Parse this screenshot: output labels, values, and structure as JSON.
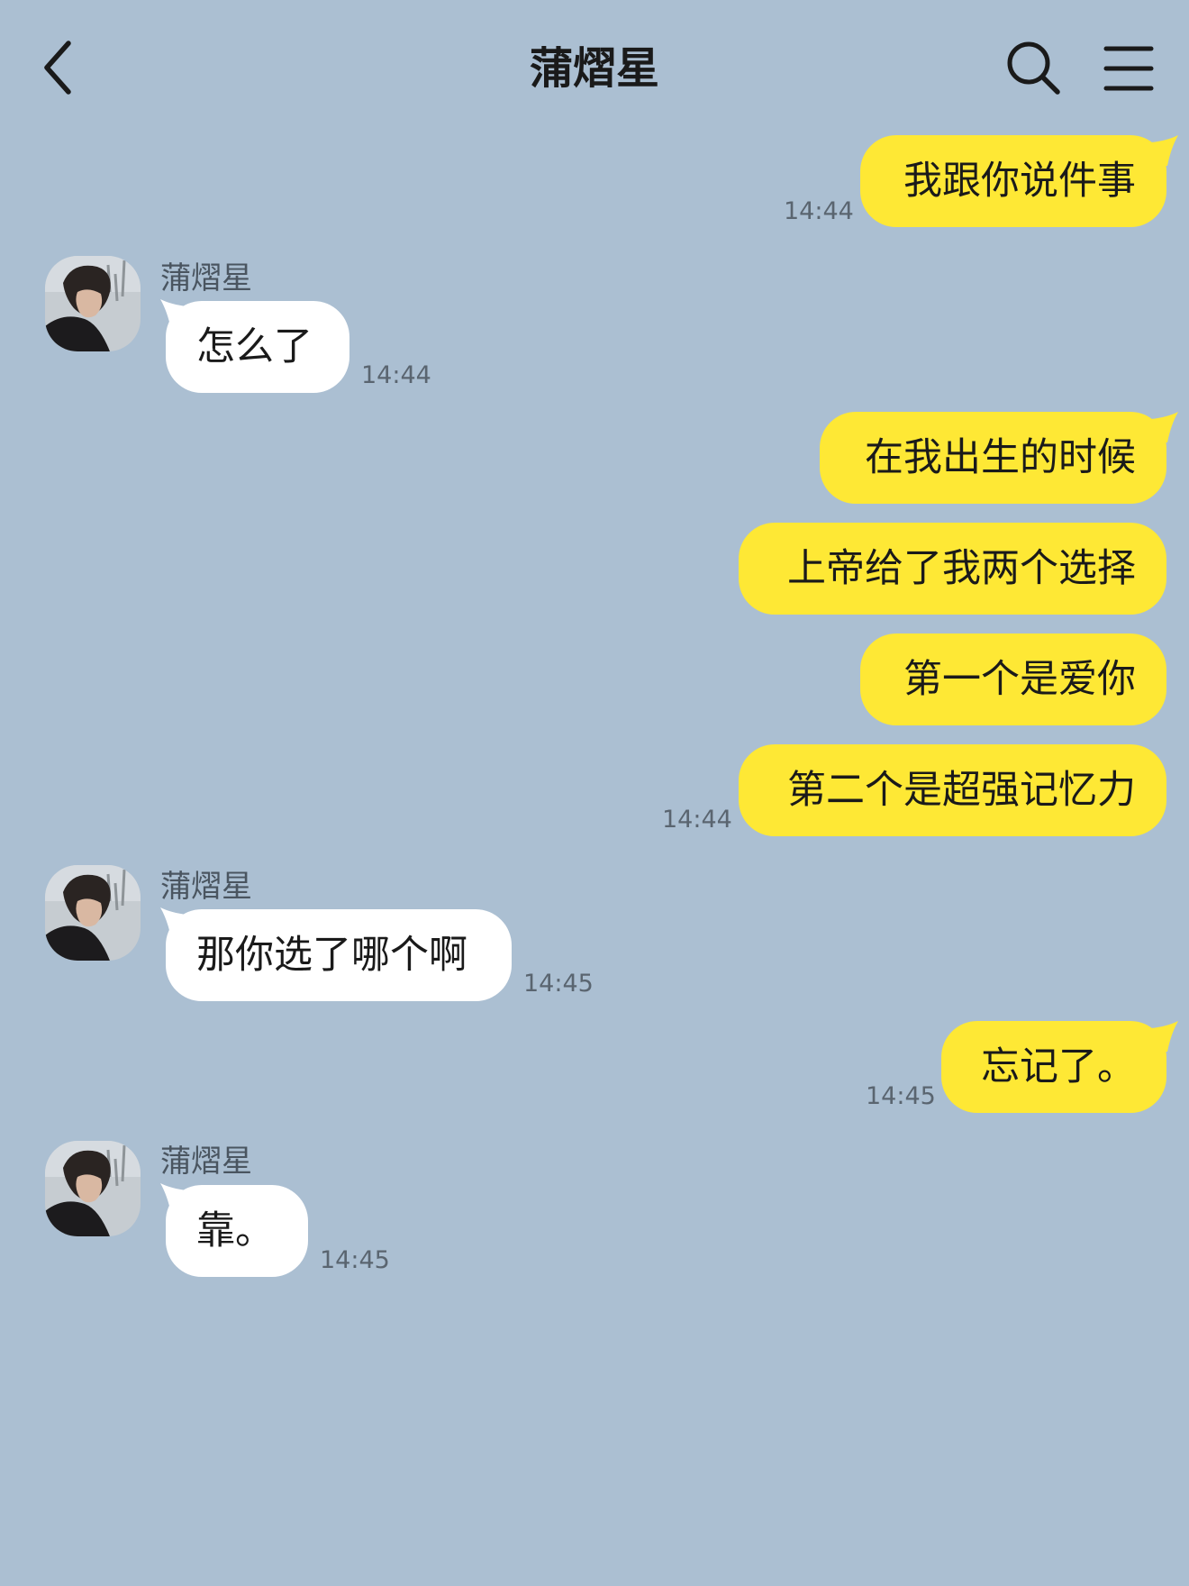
{
  "header": {
    "title": "蒲熠星",
    "back_icon": "chevron-left-icon",
    "search_icon": "search-icon",
    "menu_icon": "hamburger-menu-icon"
  },
  "colors": {
    "background": "#abbfd2",
    "my_bubble": "#fee835",
    "their_bubble": "#ffffff"
  },
  "messages": [
    {
      "from": "me",
      "text": "我跟你说件事",
      "time": "14:44"
    },
    {
      "from": "them",
      "sender": "蒲熠星",
      "text": "怎么了",
      "time": "14:44"
    },
    {
      "from": "me",
      "text": "在我出生的时候"
    },
    {
      "from": "me",
      "text": "上帝给了我两个选择"
    },
    {
      "from": "me",
      "text": "第一个是爱你"
    },
    {
      "from": "me",
      "text": "第二个是超强记忆力",
      "time": "14:44"
    },
    {
      "from": "them",
      "sender": "蒲熠星",
      "text": "那你选了哪个啊",
      "time": "14:45"
    },
    {
      "from": "me",
      "text": "忘记了。",
      "time": "14:45"
    },
    {
      "from": "them",
      "sender": "蒲熠星",
      "text": "靠。",
      "time": "14:45"
    }
  ]
}
